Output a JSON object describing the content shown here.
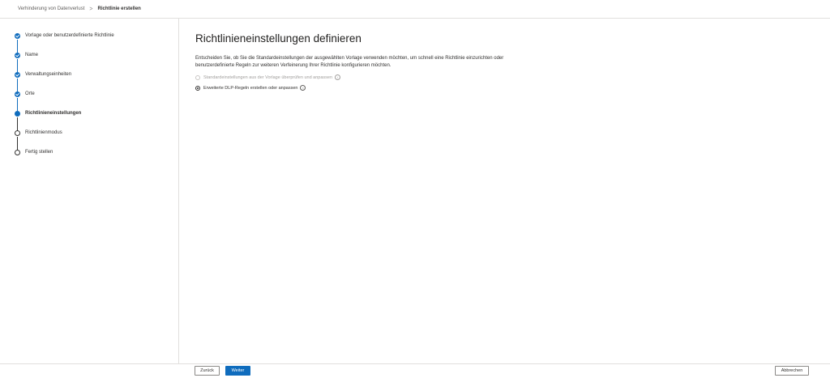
{
  "breadcrumb": {
    "parent": "Verhinderung von Datenverlust",
    "separator": ">",
    "current": "Richtlinie erstellen"
  },
  "steps": [
    {
      "label": "Vorlage oder benutzerdefinierte Richtlinie",
      "state": "done"
    },
    {
      "label": "Name",
      "state": "done"
    },
    {
      "label": "Verwaltungseinheiten",
      "state": "done"
    },
    {
      "label": "Orte",
      "state": "done"
    },
    {
      "label": "Richtlinieneinstellungen",
      "state": "current"
    },
    {
      "label": "Richtlinienmodus",
      "state": "todo"
    },
    {
      "label": "Fertig stellen",
      "state": "todo"
    }
  ],
  "main": {
    "title": "Richtlinieneinstellungen definieren",
    "description": "Entscheiden Sie, ob Sie die Standardeinstellungen der ausgewählten Vorlage verwenden möchten, um schnell eine Richtlinie einzurichten oder benutzerdefinierte Regeln zur weiteren Verfeinerung Ihrer Richtlinie konfigurieren möchten.",
    "options": [
      {
        "label": "Standardeinstellungen aus der Vorlage überprüfen und anpassen",
        "checked": false,
        "disabled": true
      },
      {
        "label": "Erweiterte DLP-Regeln erstellen oder anpassen",
        "checked": true,
        "disabled": false
      }
    ],
    "info_glyph": "i"
  },
  "footer": {
    "back_label": "Zurück",
    "next_label": "Weiter",
    "cancel_label": "Abbrechen"
  },
  "colors": {
    "accent": "#0f6cbd"
  }
}
